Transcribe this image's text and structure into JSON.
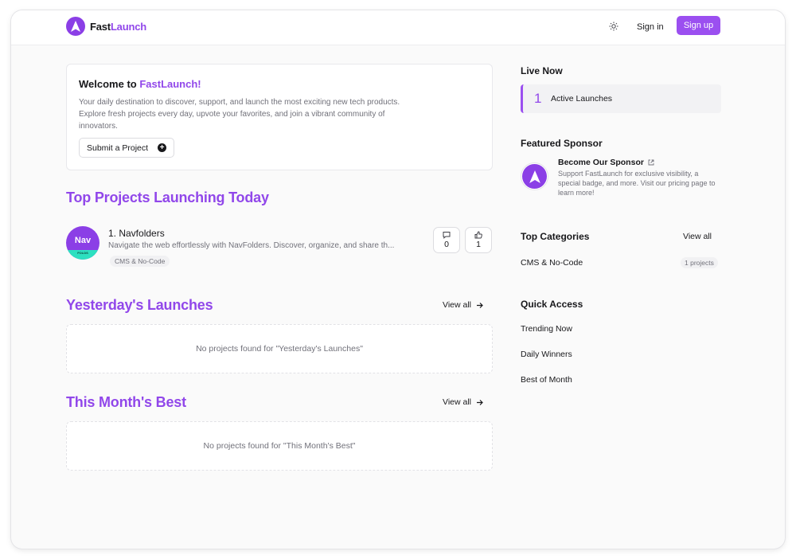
{
  "header": {
    "brand_part1": "Fast",
    "brand_part2": "Launch",
    "signin_label": "Sign in",
    "signup_label": "Sign up"
  },
  "welcome": {
    "title_prefix": "Welcome to ",
    "title_brand": "FastLaunch!",
    "description": "Your daily destination to discover, support, and launch the most exciting new tech products. Explore fresh projects every day, upvote your favorites, and join a vibrant community of innovators.",
    "submit_label": "Submit a Project"
  },
  "today": {
    "title": "Top Projects Launching Today",
    "projects": [
      {
        "logo_text": "Nav",
        "logo_sub": "FOLDS",
        "name": "1. Navfolders",
        "description": "Navigate the web effortlessly with NavFolders. Discover, organize, and share th...",
        "tag": "CMS & No-Code",
        "comments": "0",
        "upvotes": "1"
      }
    ]
  },
  "yesterday": {
    "title": "Yesterday's Launches",
    "view_all": "View all",
    "empty": "No projects found for \"Yesterday's Launches\""
  },
  "month": {
    "title": "This Month's Best",
    "view_all": "View all",
    "empty": "No projects found for \"This Month's Best\""
  },
  "sidebar": {
    "live_title": "Live Now",
    "live_count": "1",
    "live_label": "Active Launches",
    "sponsor_heading": "Featured Sponsor",
    "sponsor_title": "Become Our Sponsor",
    "sponsor_desc": "Support FastLaunch for exclusive visibility, a special badge, and more. Visit our pricing page to learn more!",
    "categories_title": "Top Categories",
    "categories_view_all": "View all",
    "categories": [
      {
        "name": "CMS & No-Code",
        "count": "1 projects"
      }
    ],
    "quick_access_title": "Quick Access",
    "quick_access": [
      "Trending Now",
      "Daily Winners",
      "Best of Month"
    ]
  },
  "colors": {
    "accent": "#9147ea",
    "button": "#9b4ff0",
    "logo_strip": "#2de0c0"
  },
  "icons": [
    "rocket-logo-icon",
    "sun-icon",
    "plus-circle-icon",
    "comment-icon",
    "thumbs-up-icon",
    "arrow-right-icon",
    "external-link-icon"
  ]
}
